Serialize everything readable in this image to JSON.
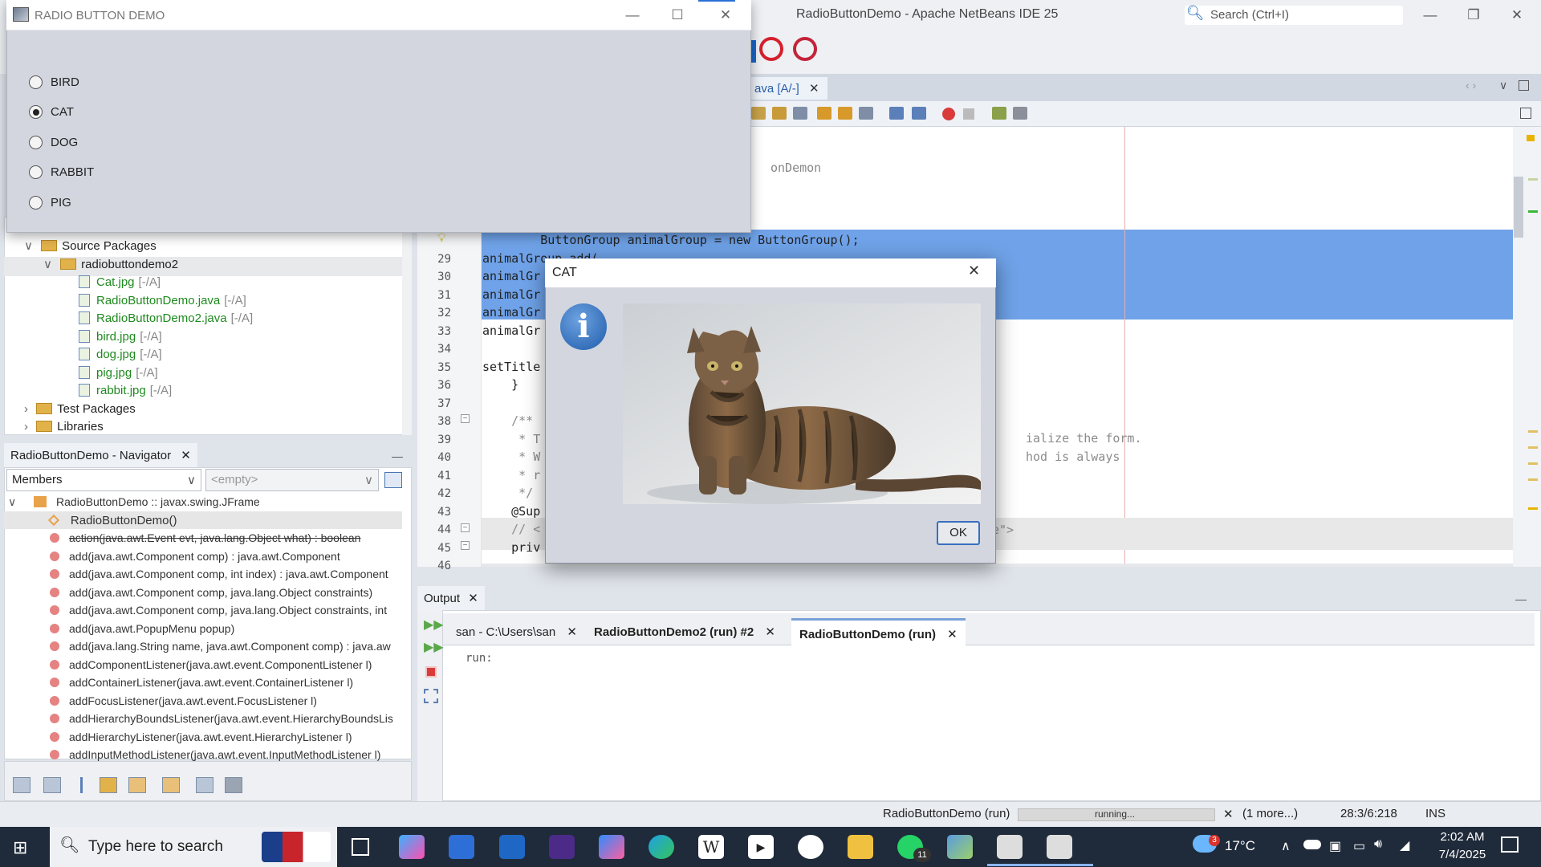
{
  "ide": {
    "title": "RadioButtonDemo - Apache NetBeans IDE 25",
    "search_placeholder": "Search (Ctrl+I)",
    "editor_tab": "ava [A/-]",
    "code_fragment_top": "onDemon",
    "code_lines": [
      {
        "ln": "",
        "text": "        ButtonGroup animalGroup = new ButtonGroup();"
      },
      {
        "ln": "29",
        "text": "animalGroup.add("
      },
      {
        "ln": "30",
        "text": "animalGr"
      },
      {
        "ln": "31",
        "text": "animalGr"
      },
      {
        "ln": "32",
        "text": "animalGr"
      },
      {
        "ln": "33",
        "text": "animalGr"
      },
      {
        "ln": "34",
        "text": ""
      },
      {
        "ln": "35",
        "text": "setTitle"
      },
      {
        "ln": "36",
        "text": "    }"
      },
      {
        "ln": "37",
        "text": ""
      },
      {
        "ln": "38",
        "text": "    /**"
      },
      {
        "ln": "39",
        "text": "     * T"
      },
      {
        "ln": "40",
        "text": "     * W"
      },
      {
        "ln": "41",
        "text": "     * r"
      },
      {
        "ln": "42",
        "text": "     */"
      },
      {
        "ln": "43",
        "text": "    @Sup"
      },
      {
        "ln": "44",
        "text": "    // <"
      },
      {
        "ln": "45",
        "text": "    priv"
      },
      {
        "ln": "46",
        "text": ""
      }
    ],
    "right_fragments": [
      "ialize the form.",
      "hod is always",
      "e\">"
    ]
  },
  "projects": {
    "items": [
      {
        "label": "Source Packages",
        "meta": "",
        "type": "folder",
        "indent": 1
      },
      {
        "label": "radiobuttondemo2",
        "meta": "",
        "type": "package",
        "indent": 2
      },
      {
        "label": "Cat.jpg",
        "meta": "[-/A]",
        "type": "file",
        "indent": 3
      },
      {
        "label": "RadioButtonDemo.java",
        "meta": "[-/A]",
        "type": "file",
        "indent": 3
      },
      {
        "label": "RadioButtonDemo2.java",
        "meta": "[-/A]",
        "type": "file",
        "indent": 3
      },
      {
        "label": "bird.jpg",
        "meta": "[-/A]",
        "type": "file",
        "indent": 3
      },
      {
        "label": "dog.jpg",
        "meta": "[-/A]",
        "type": "file",
        "indent": 3
      },
      {
        "label": "pig.jpg",
        "meta": "[-/A]",
        "type": "file",
        "indent": 3
      },
      {
        "label": "rabbit.jpg",
        "meta": "[-/A]",
        "type": "file",
        "indent": 3
      },
      {
        "label": "Test Packages",
        "meta": "",
        "type": "folder",
        "indent": 1
      },
      {
        "label": "Libraries",
        "meta": "",
        "type": "folder",
        "indent": 1
      }
    ]
  },
  "navigator": {
    "tab": "RadioButtonDemo - Navigator",
    "filter": "Members",
    "filter2": "<empty>",
    "root": "RadioButtonDemo :: javax.swing.JFrame",
    "constructor": "RadioButtonDemo()",
    "members": [
      "action(java.awt.Event evt, java.lang.Object what) : boolean",
      "add(java.awt.Component comp) : java.awt.Component",
      "add(java.awt.Component comp, int index) : java.awt.Component",
      "add(java.awt.Component comp, java.lang.Object constraints)",
      "add(java.awt.Component comp, java.lang.Object constraints, int",
      "add(java.awt.PopupMenu popup)",
      "add(java.lang.String name, java.awt.Component comp) : java.aw",
      "addComponentListener(java.awt.event.ComponentListener l)",
      "addContainerListener(java.awt.event.ContainerListener l)",
      "addFocusListener(java.awt.event.FocusListener l)",
      "addHierarchyBoundsListener(java.awt.event.HierarchyBoundsLis",
      "addHierarchyListener(java.awt.event.HierarchyListener l)",
      "addInputMethodListener(java.awt.event.InputMethodListener l)"
    ]
  },
  "output": {
    "tab": "Output",
    "tabs": [
      "san - C:\\Users\\san",
      "RadioButtonDemo2 (run) #2",
      "RadioButtonDemo (run)"
    ],
    "text": "run:"
  },
  "status": {
    "task": "RadioButtonDemo (run)",
    "progress": "running...",
    "more": "(1 more...)",
    "position": "28:3/6:218",
    "mode": "INS"
  },
  "taskbar": {
    "search_placeholder": "Type here to search",
    "weather": "17°C",
    "weather_badge": "3",
    "whatsapp_badge": "11",
    "time": "2:02 AM",
    "date": "7/4/2025"
  },
  "demo": {
    "title": "RADIO BUTTON DEMO",
    "options": [
      {
        "label": "BIRD",
        "selected": false
      },
      {
        "label": "CAT",
        "selected": true
      },
      {
        "label": "DOG",
        "selected": false
      },
      {
        "label": "RABBIT",
        "selected": false
      },
      {
        "label": "PIG",
        "selected": false
      }
    ]
  },
  "dialog": {
    "title": "CAT",
    "ok_label": "OK"
  }
}
